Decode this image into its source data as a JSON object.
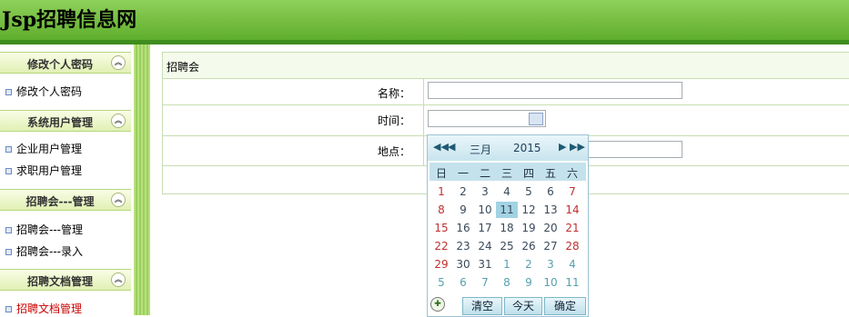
{
  "header": {
    "title": "Jsp招聘信息网"
  },
  "sidebar": {
    "sections": [
      {
        "title": "修改个人密码",
        "items": [
          {
            "label": "修改个人密码"
          }
        ]
      },
      {
        "title": "系统用户管理",
        "items": [
          {
            "label": "企业用户管理"
          },
          {
            "label": "求职用户管理"
          }
        ]
      },
      {
        "title": "招聘会---管理",
        "items": [
          {
            "label": "招聘会---管理"
          },
          {
            "label": "招聘会---录入"
          }
        ]
      },
      {
        "title": "招聘文档管理",
        "items": [
          {
            "label": "招聘文档管理"
          }
        ]
      }
    ],
    "toggle_icon": "collapse-up-icon"
  },
  "form": {
    "title": "招聘会",
    "name_label": "名称：",
    "name_value": "",
    "time_label": "时间：",
    "time_value": "",
    "place_label": "地点：",
    "place_value": ""
  },
  "calendar": {
    "month": "三月",
    "year": "2015",
    "weekdays": [
      "日",
      "一",
      "二",
      "三",
      "四",
      "五",
      "六"
    ],
    "weeks": [
      [
        "1",
        "2",
        "3",
        "4",
        "5",
        "6",
        "7"
      ],
      [
        "8",
        "9",
        "10",
        "11",
        "12",
        "13",
        "14"
      ],
      [
        "15",
        "16",
        "17",
        "18",
        "19",
        "20",
        "21"
      ],
      [
        "22",
        "23",
        "24",
        "25",
        "26",
        "27",
        "28"
      ],
      [
        "29",
        "30",
        "31",
        "1",
        "2",
        "3",
        "4"
      ],
      [
        "5",
        "6",
        "7",
        "8",
        "9",
        "10",
        "11"
      ]
    ],
    "selected": "11",
    "clear_label": "清空",
    "today_label": "今天",
    "ok_label": "确定"
  }
}
